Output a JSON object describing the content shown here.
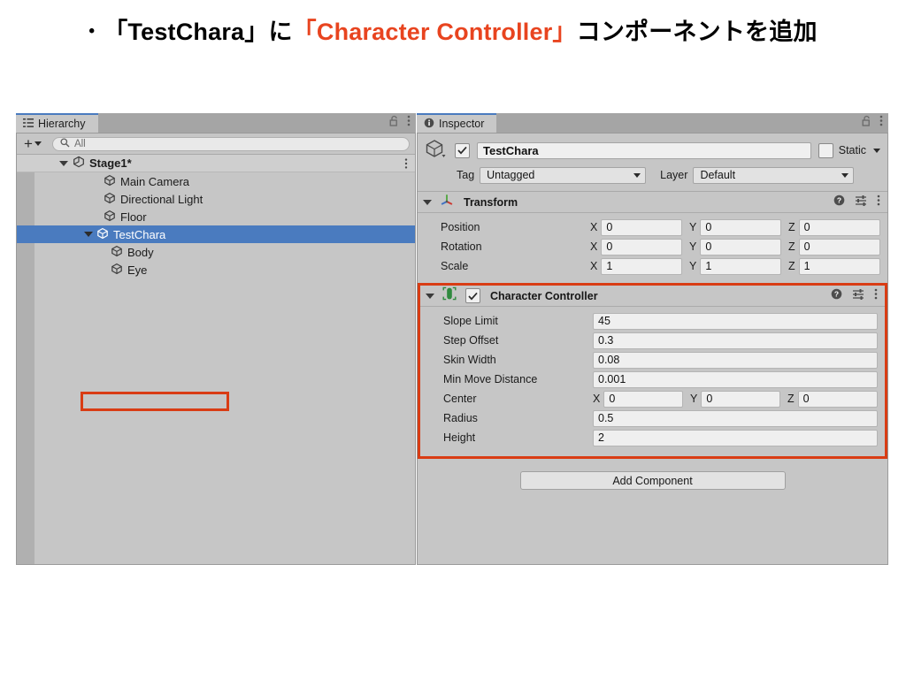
{
  "slide": {
    "bullet": "•",
    "text_part1": "「TestChara」に ",
    "text_highlight": "「Character Controller」",
    "text_part2": " コンポーネントを追加",
    "highlight_color": "#e8441f"
  },
  "hierarchy": {
    "tab_label": "Hierarchy",
    "tab_icon": "hierarchy-list-icon",
    "lock_icon": "padlock-open-icon",
    "menu_icon": "kebab-menu-icon",
    "create_label": "+",
    "search_placeholder": "All",
    "search_icon": "search-icon",
    "scene": {
      "name": "Stage1*",
      "icon": "unity-scene-icon",
      "expanded": true
    },
    "items": [
      {
        "name": "Main Camera",
        "icon": "gameobject-cube-icon",
        "depth": 1,
        "expandable": false,
        "selected": false
      },
      {
        "name": "Directional Light",
        "icon": "gameobject-cube-icon",
        "depth": 1,
        "expandable": false,
        "selected": false
      },
      {
        "name": "Floor",
        "icon": "gameobject-cube-icon",
        "depth": 1,
        "expandable": false,
        "selected": false
      },
      {
        "name": "TestChara",
        "icon": "gameobject-cube-icon",
        "depth": 1,
        "expandable": true,
        "selected": true
      },
      {
        "name": "Body",
        "icon": "gameobject-cube-icon",
        "depth": 2,
        "expandable": false,
        "selected": false
      },
      {
        "name": "Eye",
        "icon": "gameobject-cube-icon",
        "depth": 2,
        "expandable": false,
        "selected": false
      }
    ],
    "selection_highlight_color": "#4a7bbf",
    "annotation_box_color": "#d93c14"
  },
  "inspector": {
    "tab_label": "Inspector",
    "tab_icon": "info-circle-icon",
    "lock_icon": "padlock-open-icon",
    "menu_icon": "kebab-menu-icon",
    "gameobject": {
      "icon": "gameobject-cube-icon",
      "enabled": true,
      "name": "TestChara",
      "static_label": "Static",
      "static_checked": false,
      "tag_label": "Tag",
      "tag_value": "Untagged",
      "layer_label": "Layer",
      "layer_value": "Default"
    },
    "components": [
      {
        "title": "Transform",
        "icon": "transform-gizmo-icon",
        "expanded": true,
        "has_checkbox": false,
        "help_icon": "help-circle-icon",
        "preset_icon": "preset-sliders-icon",
        "menu_icon": "kebab-menu-icon",
        "properties": [
          {
            "label": "Position",
            "type": "vector3",
            "x": "0",
            "y": "0",
            "z": "0"
          },
          {
            "label": "Rotation",
            "type": "vector3",
            "x": "0",
            "y": "0",
            "z": "0"
          },
          {
            "label": "Scale",
            "type": "vector3",
            "x": "1",
            "y": "1",
            "z": "1"
          }
        ]
      },
      {
        "title": "Character Controller",
        "icon": "character-controller-capsule-icon",
        "expanded": true,
        "has_checkbox": true,
        "enabled": true,
        "highlighted": true,
        "help_icon": "help-circle-icon",
        "preset_icon": "preset-sliders-icon",
        "menu_icon": "kebab-menu-icon",
        "properties": [
          {
            "label": "Slope Limit",
            "type": "single",
            "value": "45"
          },
          {
            "label": "Step Offset",
            "type": "single",
            "value": "0.3"
          },
          {
            "label": "Skin Width",
            "type": "single",
            "value": "0.08"
          },
          {
            "label": "Min Move Distance",
            "type": "single",
            "value": "0.001"
          },
          {
            "label": "Center",
            "type": "vector3",
            "x": "0",
            "y": "0",
            "z": "0"
          },
          {
            "label": "Radius",
            "type": "single",
            "value": "0.5"
          },
          {
            "label": "Height",
            "type": "single",
            "value": "2"
          }
        ]
      }
    ],
    "axis_labels": {
      "x": "X",
      "y": "Y",
      "z": "Z"
    },
    "add_component_label": "Add Component"
  }
}
